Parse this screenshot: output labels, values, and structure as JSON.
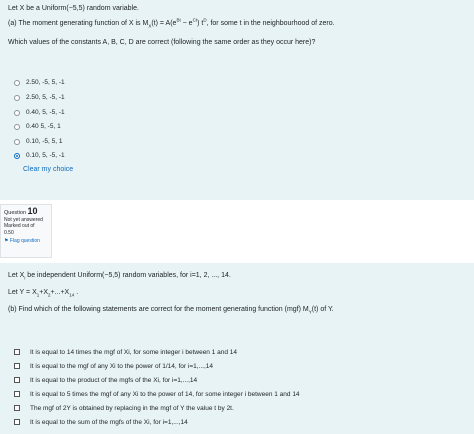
{
  "q9": {
    "intro": "Let X be a Uniform(−5,5) random variable.",
    "part_a_prefix": "(a) The moment generating function of X is M",
    "part_a_sub": "X",
    "part_a_mid": "(t) = A(e",
    "sup1": "Bt",
    "mid2": " − e",
    "sup2": "Ct",
    "mid3": ") t",
    "sup3": "D",
    "part_a_suffix": ", for some t in the neighbourhood of zero.",
    "question": "Which values of the constants A, B, C, D are correct (following the same order as they occur here)?",
    "options": [
      "2.50, -5, 5, -1",
      "2.50, 5, -5, -1",
      "0.40, 5, -5, -1",
      "0.40 5, -5, 1",
      "0.10, -5, 5, 1",
      "0.10, 5, -5, -1"
    ],
    "selected_index": 5,
    "clear_label": "Clear my choice"
  },
  "q10_info": {
    "question_label": "Question",
    "question_number": "10",
    "status": "Not yet answered",
    "marked_out_of": "Marked out of",
    "marks": "0.50",
    "flag_label": "Flag question"
  },
  "q10": {
    "intro_prefix": "Let X",
    "intro_sub": "i",
    "intro_suffix": " be independent Uniform(−5,5) random variables, for i=1, 2, ..., 14.",
    "y_prefix": "Let Y = X",
    "y_s1": "1",
    "y_mid1": "+X",
    "y_s2": "2",
    "y_mid2": "+...+X",
    "y_s3": "14",
    "y_suffix": " .",
    "part_b_prefix": "(b) Find which of the following statements are correct for the moment generating function (mgf) M",
    "part_b_sub": "Y",
    "part_b_suffix": "(t) of Y.",
    "options": [
      "It is equal to 14 times the mgf of Xi, for some integer i between 1 and 14",
      "It is equal to the mgf of any Xi to the power of 1/14, for i=1,...,14",
      "It is equal to the product of the mgfs of the Xi, for i=1,...,14",
      "It is equal to 5 times the mgf of any Xi to the power of 14, for some integer i between 1 and 14",
      "The mgf of 2Y is obtained by replacing in the mgf of Y the value t by 2t.",
      "It is equal to the sum of the mgfs of the Xi, for i=1,...,14"
    ]
  },
  "colors": {
    "card": "#e7f3f5",
    "accent": "#0f6cbf"
  }
}
